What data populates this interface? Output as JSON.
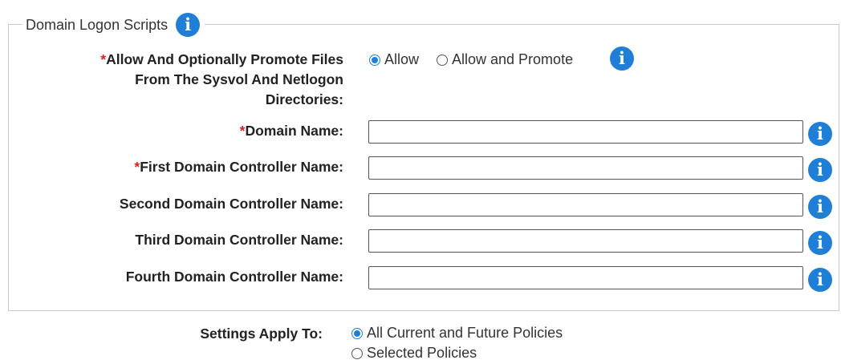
{
  "section": {
    "legend": "Domain Logon Scripts",
    "info_glyph": "i"
  },
  "promote": {
    "required_mark": "*",
    "label_line1": "Allow And Optionally Promote Files",
    "label_line2": "From The Sysvol And Netlogon",
    "label_line3": "Directories:",
    "option_allow": "Allow",
    "option_allow_promote": "Allow and Promote",
    "selected": "Allow"
  },
  "fields": [
    {
      "label": "Domain Name:",
      "required": true,
      "required_mark": "*",
      "value": ""
    },
    {
      "label": "First Domain Controller Name:",
      "required": true,
      "required_mark": "*",
      "value": ""
    },
    {
      "label": "Second Domain Controller Name:",
      "required": false,
      "value": ""
    },
    {
      "label": "Third Domain Controller Name:",
      "required": false,
      "value": ""
    },
    {
      "label": "Fourth Domain Controller Name:",
      "required": false,
      "value": ""
    }
  ],
  "settings": {
    "label": "Settings Apply To:",
    "option_all": "All Current and Future Policies",
    "option_selected": "Selected Policies",
    "selected": "All Current and Future Policies"
  },
  "colors": {
    "accent": "#1f7fd6",
    "required": "#e02020",
    "border": "#c8c8c8"
  }
}
